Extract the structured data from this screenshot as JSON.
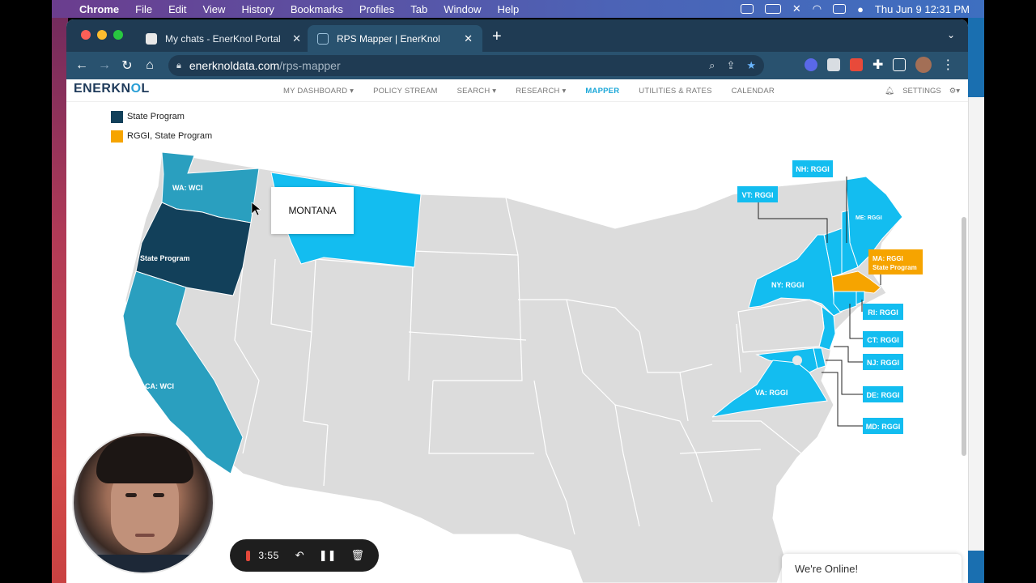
{
  "menubar": {
    "app_name": "Chrome",
    "items": [
      "File",
      "Edit",
      "View",
      "History",
      "Bookmarks",
      "Profiles",
      "Tab",
      "Window",
      "Help"
    ],
    "clock": "Thu Jun 9  12:31 PM"
  },
  "browser": {
    "tabs": [
      {
        "title": "My chats - EnerKnol Portal",
        "close": "✕"
      },
      {
        "title": "RPS Mapper | EnerKnol",
        "close": "✕"
      }
    ],
    "new_tab": "+",
    "tab_menu": "⌄",
    "url_host": "enerknoldata.com",
    "url_path": "/rps-mapper"
  },
  "site": {
    "logo_a": "ENER",
    "logo_b": "KN",
    "logo_c": "O",
    "logo_d": "L",
    "nav": [
      {
        "label": "MY DASHBOARD",
        "caret": "▾"
      },
      {
        "label": "POLICY STREAM",
        "caret": ""
      },
      {
        "label": "SEARCH",
        "caret": "▾"
      },
      {
        "label": "RESEARCH",
        "caret": "▾"
      },
      {
        "label": "MAPPER",
        "caret": ""
      },
      {
        "label": "UTILITIES & RATES",
        "caret": ""
      },
      {
        "label": "CALENDAR",
        "caret": ""
      }
    ],
    "settings_label": "SETTINGS"
  },
  "legend": [
    {
      "label": "State Program",
      "color": "#12405a"
    },
    {
      "label": "RGGI, State Program",
      "color": "#f6a400"
    }
  ],
  "map": {
    "colors": {
      "wci": "#2a9fbf",
      "state_program": "#12405a",
      "rggi": "#13bdf0",
      "rggi_state": "#f6a400",
      "none": "#dcdcdc"
    },
    "labels": {
      "wa": "WA: WCI",
      "or": "State Program",
      "ca": "CA: WCI",
      "ny": "NY: RGGI",
      "va": "VA: RGGI",
      "me": "ME: RGGI"
    },
    "callouts": {
      "nh": "NH: RGGI",
      "vt": "VT: RGGI",
      "ma_1": "MA: RGGI",
      "ma_2": "State Program",
      "ri": "RI: RGGI",
      "ct": "CT: RGGI",
      "nj": "NJ: RGGI",
      "de": "DE: RGGI",
      "md": "MD: RGGI"
    },
    "tooltip": "MONTANA"
  },
  "recorder": {
    "time": "3:55"
  },
  "chat": {
    "status": "We're Online!"
  }
}
